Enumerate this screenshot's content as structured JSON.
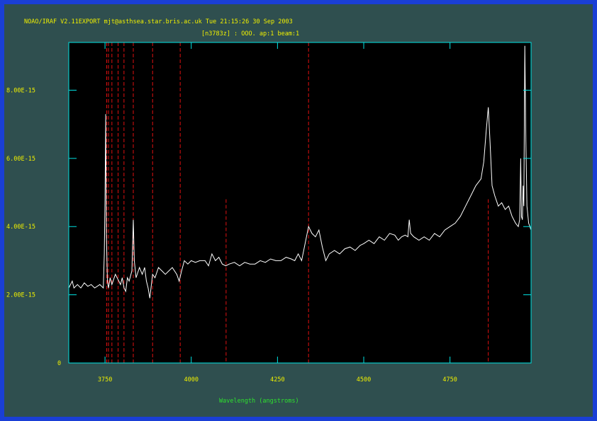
{
  "header": {
    "line1": "NOAO/IRAF V2.11EXPORT mjt@asthsea.star.bris.ac.uk Tue 21:15:26 30 Sep 2003",
    "line2": "[n3783z] : OOO. ap:1 beam:1"
  },
  "colors": {
    "page_border": "#1a3fd6",
    "panel": "#2f4f4f",
    "plot_bg": "#000000",
    "axes": "#00e5e5",
    "spectrum": "#ffffff",
    "marker_lines": "#e01010",
    "tick_labels": "#f0f000",
    "axis_label": "#2ee02e"
  },
  "chart_data": {
    "type": "line",
    "title": "[n3783z] : OOO. ap:1 beam:1",
    "xlabel": "Wavelength (angstroms)",
    "ylabel": "",
    "xlim": [
      3645,
      4985
    ],
    "ylim": [
      0,
      9.4e-15
    ],
    "x_ticks": [
      3750,
      4000,
      4250,
      4500,
      4750
    ],
    "x_tick_labels": [
      "3750",
      "4000",
      "4250",
      "4500",
      "4750"
    ],
    "y_ticks": [
      0,
      2e-15,
      4e-15,
      6e-15,
      8e-15
    ],
    "y_tick_labels": [
      "0",
      "2.00E-15",
      "4.00E-15",
      "6.00E-15",
      "8.00E-15"
    ],
    "grid": false,
    "marker_lines": [
      {
        "x": 3755,
        "top": 9.4e-15
      },
      {
        "x": 3760,
        "top": 9.4e-15
      },
      {
        "x": 3770,
        "top": 9.4e-15
      },
      {
        "x": 3788,
        "top": 9.4e-15
      },
      {
        "x": 3805,
        "top": 9.4e-15
      },
      {
        "x": 3832,
        "top": 9.4e-15
      },
      {
        "x": 3888,
        "top": 9.4e-15
      },
      {
        "x": 3968,
        "top": 9.4e-15
      },
      {
        "x": 4101,
        "top": 4.8e-15
      },
      {
        "x": 4340,
        "top": 9.4e-15
      },
      {
        "x": 4861,
        "top": 4.8e-15
      }
    ],
    "series": [
      {
        "values": [
          [
            3645,
            2.2e-15
          ],
          [
            3655,
            2.4e-15
          ],
          [
            3660,
            2.2e-15
          ],
          [
            3670,
            2.3e-15
          ],
          [
            3680,
            2.2e-15
          ],
          [
            3690,
            2.35e-15
          ],
          [
            3700,
            2.25e-15
          ],
          [
            3710,
            2.3e-15
          ],
          [
            3720,
            2.2e-15
          ],
          [
            3735,
            2.3e-15
          ],
          [
            3745,
            2.2e-15
          ],
          [
            3748,
            3.2e-15
          ],
          [
            3750,
            4.8e-15
          ],
          [
            3752,
            7.3e-15
          ],
          [
            3754,
            3.8e-15
          ],
          [
            3757,
            2.4e-15
          ],
          [
            3760,
            2.2e-15
          ],
          [
            3765,
            2.5e-15
          ],
          [
            3770,
            2.3e-15
          ],
          [
            3780,
            2.6e-15
          ],
          [
            3790,
            2.4e-15
          ],
          [
            3795,
            2.3e-15
          ],
          [
            3800,
            2.5e-15
          ],
          [
            3805,
            2.2e-15
          ],
          [
            3810,
            2.1e-15
          ],
          [
            3815,
            2.5e-15
          ],
          [
            3820,
            2.4e-15
          ],
          [
            3828,
            2.7e-15
          ],
          [
            3832,
            4.2e-15
          ],
          [
            3835,
            3e-15
          ],
          [
            3840,
            2.5e-15
          ],
          [
            3850,
            2.8e-15
          ],
          [
            3858,
            2.6e-15
          ],
          [
            3865,
            2.8e-15
          ],
          [
            3870,
            2.4e-15
          ],
          [
            3875,
            2.2e-15
          ],
          [
            3880,
            1.9e-15
          ],
          [
            3888,
            2.6e-15
          ],
          [
            3895,
            2.5e-15
          ],
          [
            3905,
            2.8e-15
          ],
          [
            3915,
            2.7e-15
          ],
          [
            3925,
            2.6e-15
          ],
          [
            3935,
            2.7e-15
          ],
          [
            3945,
            2.8e-15
          ],
          [
            3958,
            2.6e-15
          ],
          [
            3965,
            2.4e-15
          ],
          [
            3972,
            2.7e-15
          ],
          [
            3980,
            3e-15
          ],
          [
            3990,
            2.9e-15
          ],
          [
            4000,
            3e-15
          ],
          [
            4012,
            2.95e-15
          ],
          [
            4025,
            3e-15
          ],
          [
            4040,
            3e-15
          ],
          [
            4050,
            2.85e-15
          ],
          [
            4060,
            3.2e-15
          ],
          [
            4070,
            3e-15
          ],
          [
            4080,
            3.1e-15
          ],
          [
            4090,
            2.9e-15
          ],
          [
            4100,
            2.85e-15
          ],
          [
            4110,
            2.9e-15
          ],
          [
            4125,
            2.95e-15
          ],
          [
            4140,
            2.85e-15
          ],
          [
            4155,
            2.95e-15
          ],
          [
            4170,
            2.9e-15
          ],
          [
            4185,
            2.9e-15
          ],
          [
            4200,
            3e-15
          ],
          [
            4215,
            2.95e-15
          ],
          [
            4230,
            3.05e-15
          ],
          [
            4245,
            3e-15
          ],
          [
            4260,
            3e-15
          ],
          [
            4275,
            3.1e-15
          ],
          [
            4290,
            3.05e-15
          ],
          [
            4300,
            3e-15
          ],
          [
            4310,
            3.2e-15
          ],
          [
            4320,
            3e-15
          ],
          [
            4330,
            3.5e-15
          ],
          [
            4340,
            4e-15
          ],
          [
            4350,
            3.8e-15
          ],
          [
            4360,
            3.7e-15
          ],
          [
            4370,
            3.9e-15
          ],
          [
            4380,
            3.4e-15
          ],
          [
            4390,
            3e-15
          ],
          [
            4400,
            3.2e-15
          ],
          [
            4415,
            3.3e-15
          ],
          [
            4430,
            3.2e-15
          ],
          [
            4445,
            3.35e-15
          ],
          [
            4460,
            3.4e-15
          ],
          [
            4475,
            3.3e-15
          ],
          [
            4490,
            3.45e-15
          ],
          [
            4500,
            3.5e-15
          ],
          [
            4515,
            3.6e-15
          ],
          [
            4530,
            3.5e-15
          ],
          [
            4545,
            3.7e-15
          ],
          [
            4560,
            3.6e-15
          ],
          [
            4575,
            3.8e-15
          ],
          [
            4590,
            3.75e-15
          ],
          [
            4600,
            3.6e-15
          ],
          [
            4610,
            3.7e-15
          ],
          [
            4620,
            3.75e-15
          ],
          [
            4628,
            3.7e-15
          ],
          [
            4632,
            4.2e-15
          ],
          [
            4636,
            3.8e-15
          ],
          [
            4645,
            3.7e-15
          ],
          [
            4660,
            3.6e-15
          ],
          [
            4675,
            3.7e-15
          ],
          [
            4690,
            3.6e-15
          ],
          [
            4705,
            3.8e-15
          ],
          [
            4720,
            3.7e-15
          ],
          [
            4735,
            3.9e-15
          ],
          [
            4750,
            4e-15
          ],
          [
            4765,
            4.1e-15
          ],
          [
            4780,
            4.3e-15
          ],
          [
            4795,
            4.6e-15
          ],
          [
            4810,
            4.9e-15
          ],
          [
            4825,
            5.2e-15
          ],
          [
            4840,
            5.4e-15
          ],
          [
            4848,
            5.9e-15
          ],
          [
            4855,
            6.8e-15
          ],
          [
            4861,
            7.5e-15
          ],
          [
            4866,
            6.5e-15
          ],
          [
            4872,
            5.2e-15
          ],
          [
            4880,
            4.9e-15
          ],
          [
            4890,
            4.6e-15
          ],
          [
            4900,
            4.7e-15
          ],
          [
            4910,
            4.5e-15
          ],
          [
            4920,
            4.6e-15
          ],
          [
            4930,
            4.3e-15
          ],
          [
            4940,
            4.1e-15
          ],
          [
            4948,
            4e-15
          ],
          [
            4952,
            4.2e-15
          ],
          [
            4955,
            6e-15
          ],
          [
            4957,
            4.3e-15
          ],
          [
            4960,
            4.2e-15
          ],
          [
            4962,
            5.2e-15
          ],
          [
            4964,
            4.6e-15
          ],
          [
            4967,
            9.3e-15
          ],
          [
            4970,
            6.5e-15
          ],
          [
            4973,
            4.6e-15
          ],
          [
            4978,
            4.1e-15
          ],
          [
            4985,
            3.9e-15
          ]
        ]
      }
    ]
  }
}
